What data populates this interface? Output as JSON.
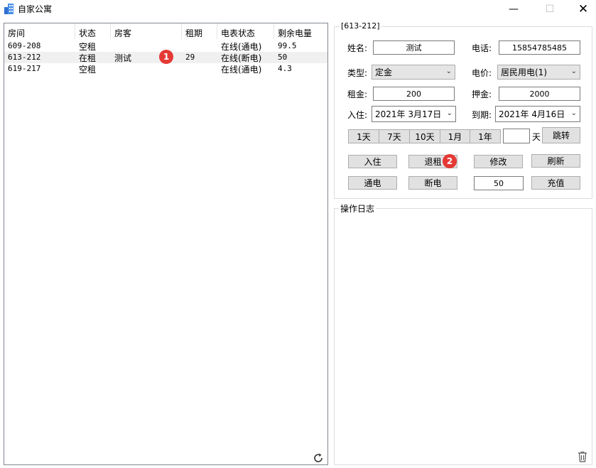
{
  "window": {
    "title": "自家公寓",
    "minimize": "—",
    "maximize": "☐",
    "close": "✕"
  },
  "list": {
    "columns": [
      "房间",
      "状态",
      "房客",
      "租期",
      "电表状态",
      "剩余电量"
    ],
    "rows": [
      {
        "room": "609-208",
        "status": "空租",
        "tenant": "",
        "term": "",
        "meter": "在线(通电)",
        "power": "99.5"
      },
      {
        "room": "613-212",
        "status": "在租",
        "tenant": "测试",
        "term": "29",
        "meter": "在线(断电)",
        "power": "50"
      },
      {
        "room": "619-217",
        "status": "空租",
        "tenant": "",
        "term": "",
        "meter": "在线(通电)",
        "power": "4.3"
      }
    ],
    "badge1": "1"
  },
  "detail": {
    "group_title": "[613-212]",
    "name_label": "姓名:",
    "name_value": "测试",
    "phone_label": "电话:",
    "phone_value": "15854785485",
    "type_label": "类型:",
    "type_value": "定金",
    "price_label": "电价:",
    "price_value": "居民用电(1)",
    "rent_label": "租金:",
    "rent_value": "200",
    "deposit_label": "押金:",
    "deposit_value": "2000",
    "checkin_label": "入住:",
    "checkin_value": "2021年  3月17日",
    "expire_label": "到期:",
    "expire_value": "2021年  4月16日",
    "periods": [
      "1天",
      "7天",
      "10天",
      "1月",
      "1年"
    ],
    "days_value": "",
    "days_unit": "天",
    "jump_label": "跳转",
    "checkin_btn": "入住",
    "checkout_btn": "退租",
    "badge2": "2",
    "modify_btn": "修改",
    "refresh_btn": "刷新",
    "power_on_btn": "通电",
    "power_off_btn": "断电",
    "charge_value": "50",
    "charge_btn": "充值"
  },
  "log": {
    "title": "操作日志"
  },
  "icons": {
    "app": "building-icon",
    "refresh": "refresh-icon",
    "trash": "trash-icon"
  }
}
